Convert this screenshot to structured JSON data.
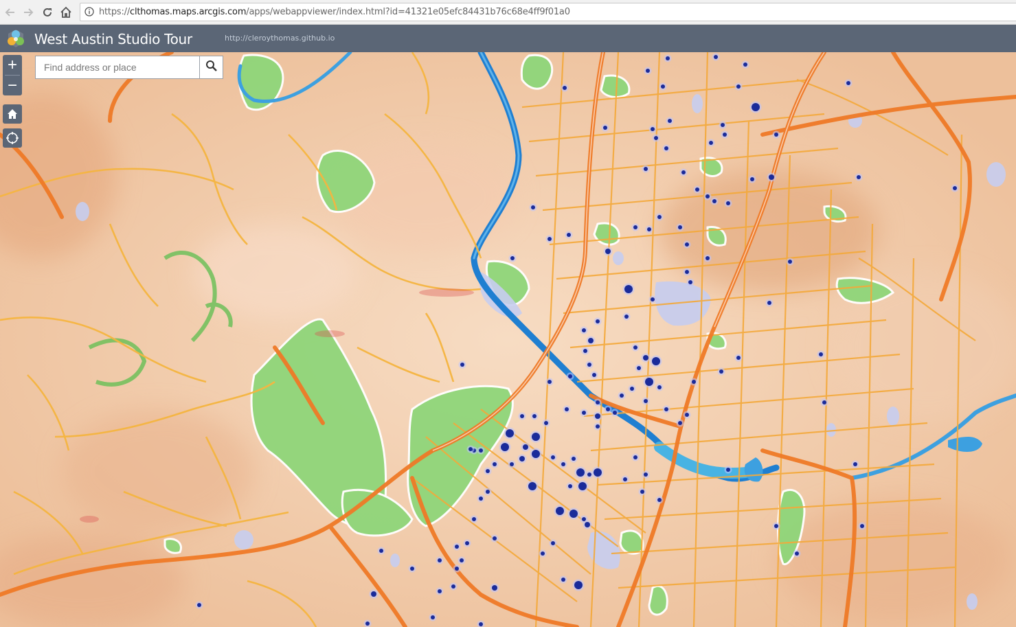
{
  "browser": {
    "url_host": "clthomas.maps.arcgis.com",
    "url_scheme": "https://",
    "url_path": "/apps/webappviewer/index.html?id=41321e05efc84431b76c68e4ff9f01a0"
  },
  "app": {
    "title": "West Austin Studio Tour",
    "link": "http://cleroythomas.github.io",
    "header_color": "#5b6676"
  },
  "search": {
    "placeholder": "Find address or place",
    "value": ""
  },
  "controls": {
    "zoom_in": "+",
    "zoom_out": "−",
    "icons": [
      "back-arrow-icon",
      "forward-arrow-icon",
      "reload-icon",
      "home-icon",
      "info-icon",
      "zoom-in-icon",
      "zoom-out-icon",
      "default-extent-home-icon",
      "locate-icon",
      "search-icon"
    ]
  },
  "map": {
    "basemap_style": "watercolor",
    "marker_color": "#1a2b9a",
    "park_color": "#8fd67a",
    "water_color": "#2a8fd6",
    "major_road_color": "#f07a2a",
    "minor_road_color": "#f5b540"
  }
}
